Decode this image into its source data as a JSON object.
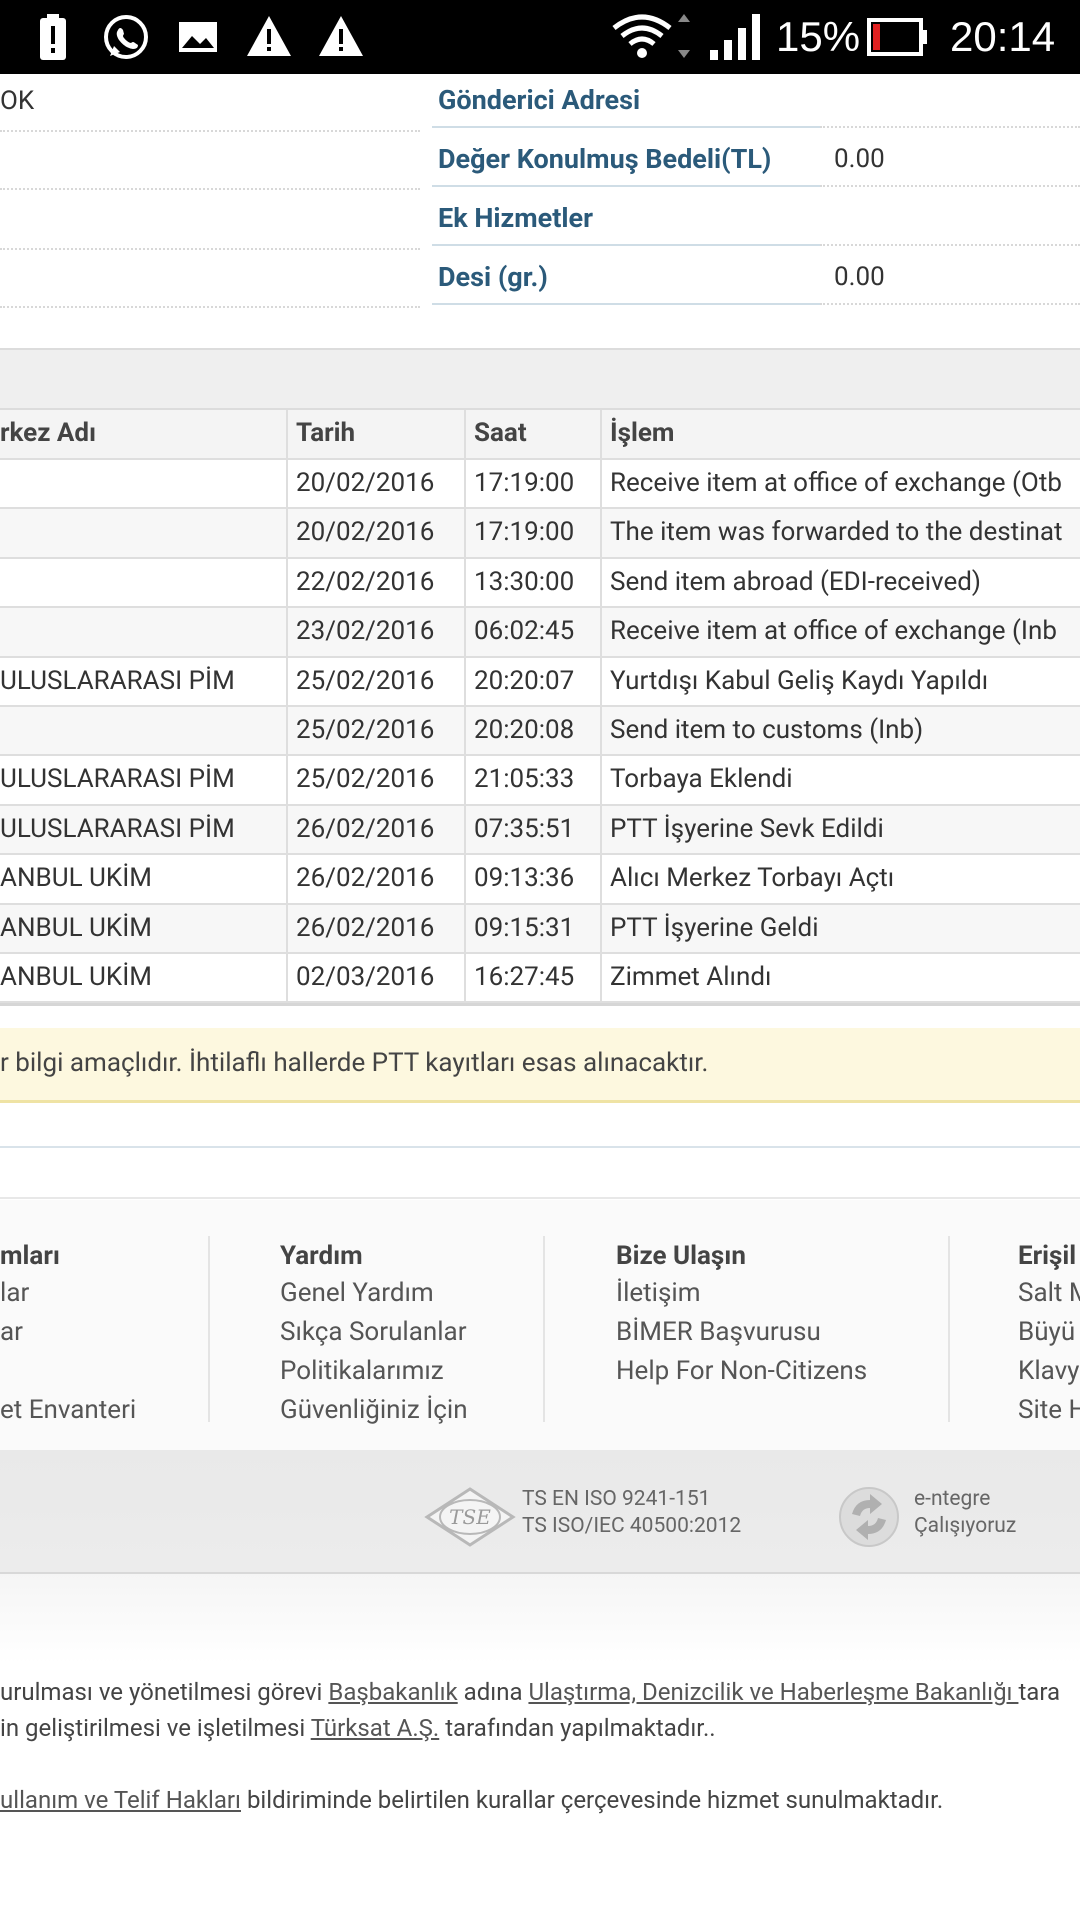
{
  "status_bar": {
    "battery_percent": "15%",
    "time": "20:14",
    "icons": [
      "alert-battery-icon",
      "whatsapp-icon",
      "gallery-icon",
      "warning-icon",
      "warning-icon",
      "wifi-icon",
      "signal-icon",
      "battery-icon"
    ]
  },
  "info": {
    "left_rows": [
      "OK",
      "",
      "",
      ""
    ],
    "right_rows": [
      {
        "label": "Gönderici Adresi",
        "value": ""
      },
      {
        "label": "Değer Konulmuş Bedeli(TL)",
        "value": "0.00"
      },
      {
        "label": "Ek Hizmetler",
        "value": ""
      },
      {
        "label": "Desi (gr.)",
        "value": "0.00"
      }
    ]
  },
  "table": {
    "headers": [
      "rkez Adı",
      "Tarih",
      "Saat",
      "İşlem"
    ],
    "rows": [
      {
        "merkez": "",
        "tarih": "20/02/2016",
        "saat": "17:19:00",
        "islem": "Receive item at office of exchange (Otb"
      },
      {
        "merkez": "",
        "tarih": "20/02/2016",
        "saat": "17:19:00",
        "islem": "The item was forwarded to the destinat"
      },
      {
        "merkez": "",
        "tarih": "22/02/2016",
        "saat": "13:30:00",
        "islem": "Send item abroad (EDI-received)"
      },
      {
        "merkez": "",
        "tarih": "23/02/2016",
        "saat": "06:02:45",
        "islem": "Receive item at office of exchange (Inb"
      },
      {
        "merkez": "ULUSLARARASI PİM",
        "tarih": "25/02/2016",
        "saat": "20:20:07",
        "islem": "Yurtdışı Kabul Geliş Kaydı Yapıldı"
      },
      {
        "merkez": "",
        "tarih": "25/02/2016",
        "saat": "20:20:08",
        "islem": "Send item to customs (Inb)"
      },
      {
        "merkez": "ULUSLARARASI PİM",
        "tarih": "25/02/2016",
        "saat": "21:05:33",
        "islem": "Torbaya Eklendi"
      },
      {
        "merkez": "ULUSLARARASI PİM",
        "tarih": "26/02/2016",
        "saat": "07:35:51",
        "islem": "PTT İşyerine Sevk Edildi"
      },
      {
        "merkez": "ANBUL UKİM",
        "tarih": "26/02/2016",
        "saat": "09:13:36",
        "islem": "Alıcı Merkez Torbayı Açtı"
      },
      {
        "merkez": "ANBUL UKİM",
        "tarih": "26/02/2016",
        "saat": "09:15:31",
        "islem": "PTT İşyerine Geldi"
      },
      {
        "merkez": "ANBUL UKİM",
        "tarih": "02/03/2016",
        "saat": "16:27:45",
        "islem": "Zimmet Alındı"
      }
    ]
  },
  "notice": "r bilgi amaçlıdır. İhtilaflı hallerde PTT kayıtları esas alınacaktır.",
  "footer": {
    "col1": {
      "heading": "mları",
      "links": [
        "lar",
        "ar",
        "",
        "et Envanteri"
      ]
    },
    "col2": {
      "heading": "Yardım",
      "links": [
        "Genel Yardım",
        "Sıkça Sorulanlar",
        "Politikalarımız",
        "Güvenliğiniz İçin"
      ]
    },
    "col3": {
      "heading": "Bize Ulaşın",
      "links": [
        "İletişim",
        "BİMER Başvurusu",
        "Help For Non-Citizens"
      ]
    },
    "col4": {
      "heading": "Erişil",
      "links": [
        "Salt M",
        "Büyü",
        "Klavy",
        "Site H"
      ]
    }
  },
  "cert": {
    "tse_logo_text": "TSE",
    "iso_line1": "TS EN ISO 9241-151",
    "iso_line2": "TS ISO/IEC 40500:2012",
    "entegre_line1": "e-ntegre",
    "entegre_line2": "Çalışıyoruz"
  },
  "bottom": {
    "line1_pre": "urulması ve yönetilmesi görevi ",
    "line1_link1": "Başbakanlık",
    "line1_mid": " adına ",
    "line1_link2": "Ulaştırma, Denizcilik ve Haberleşme Bakanlığı ",
    "line1_post": "tara",
    "line2_pre": "in geliştirilmesi ve işletilmesi ",
    "line2_link": "Türksat A.Ş.",
    "line2_post": " tarafından yapılmaktadır..",
    "line3_link": "ullanım ve Telif Hakları",
    "line3_post": " bildiriminde belirtilen kurallar çerçevesinde hizmet sunulmaktadır."
  }
}
